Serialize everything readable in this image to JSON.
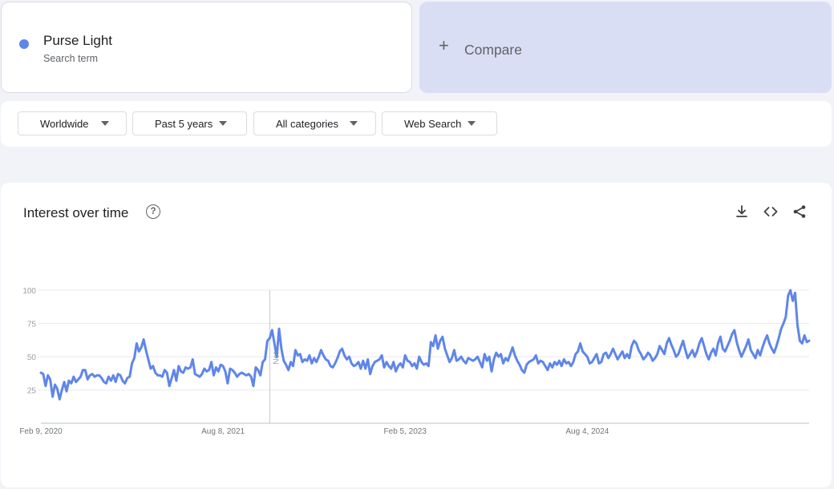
{
  "search_term": {
    "name": "Purse Light",
    "subtitle": "Search term",
    "color": "#5f86e8"
  },
  "compare": {
    "label": "Compare"
  },
  "filters": [
    {
      "label": "Worldwide"
    },
    {
      "label": "Past 5 years"
    },
    {
      "label": "All categories"
    },
    {
      "label": "Web Search"
    }
  ],
  "chart_card": {
    "title": "Interest over time",
    "icons": [
      "help-icon",
      "download-icon",
      "embed-code-icon",
      "share-icon"
    ]
  },
  "chart_data": {
    "type": "line",
    "title": "Interest over time",
    "xlabel": "",
    "ylabel": "",
    "ylim": [
      0,
      100
    ],
    "yticks": [
      25,
      50,
      75,
      100
    ],
    "x_tick_labels": [
      {
        "label": "Feb 9, 2020",
        "week_index": 0
      },
      {
        "label": "Aug 8, 2021",
        "week_index": 78
      },
      {
        "label": "Feb 5, 2023",
        "week_index": 156
      },
      {
        "label": "Aug 4, 2024",
        "week_index": 234
      }
    ],
    "annotation": {
      "label": "Note",
      "week_index": 98
    },
    "grid": true,
    "legend": "none",
    "series": [
      {
        "color": "#5f86e8",
        "x_start": "Feb 9, 2020",
        "x_step": "1 week",
        "values": [
          38,
          37,
          28,
          36,
          33,
          20,
          29,
          26,
          18,
          25,
          31,
          24,
          32,
          30,
          35,
          31,
          33,
          35,
          40,
          40,
          33,
          36,
          37,
          35,
          36,
          36,
          34,
          31,
          30,
          35,
          32,
          36,
          31,
          37,
          36,
          32,
          30,
          34,
          35,
          45,
          49,
          60,
          54,
          57,
          63,
          55,
          48,
          41,
          43,
          38,
          36,
          36,
          35,
          40,
          38,
          28,
          34,
          40,
          32,
          43,
          39,
          38,
          42,
          41,
          42,
          48,
          37,
          36,
          35,
          37,
          41,
          39,
          40,
          46,
          36,
          42,
          39,
          44,
          43,
          39,
          30,
          41,
          40,
          38,
          35,
          37,
          38,
          37,
          36,
          37,
          35,
          28,
          42,
          40,
          36,
          46,
          48,
          62,
          64,
          70,
          60,
          50,
          71,
          56,
          47,
          44,
          40,
          46,
          43,
          55,
          51,
          52,
          46,
          48,
          47,
          51,
          45,
          49,
          46,
          50,
          55,
          51,
          48,
          47,
          43,
          42,
          45,
          49,
          54,
          56,
          51,
          48,
          50,
          45,
          43,
          44,
          46,
          41,
          47,
          41,
          48,
          37,
          43,
          46,
          47,
          48,
          51,
          42,
          46,
          43,
          41,
          46,
          39,
          43,
          45,
          42,
          51,
          47,
          46,
          43,
          45,
          41,
          50,
          46,
          44,
          45,
          43,
          61,
          58,
          66,
          56,
          62,
          65,
          56,
          51,
          46,
          49,
          55,
          47,
          48,
          50,
          47,
          45,
          49,
          48,
          47,
          48,
          50,
          46,
          42,
          52,
          47,
          50,
          39,
          48,
          53,
          50,
          52,
          45,
          49,
          47,
          52,
          57,
          51,
          47,
          44,
          40,
          38,
          44,
          46,
          47,
          48,
          51,
          45,
          47,
          46,
          43,
          40,
          45,
          42,
          46,
          44,
          47,
          43,
          48,
          45,
          46,
          43,
          46,
          52,
          54,
          60,
          54,
          52,
          50,
          45,
          46,
          49,
          52,
          45,
          46,
          52,
          53,
          49,
          52,
          56,
          52,
          48,
          51,
          54,
          49,
          52,
          49,
          58,
          62,
          60,
          55,
          52,
          48,
          50,
          53,
          51,
          47,
          49,
          52,
          58,
          55,
          52,
          60,
          64,
          59,
          55,
          50,
          52,
          57,
          62,
          55,
          49,
          52,
          55,
          50,
          54,
          60,
          64,
          58,
          52,
          48,
          53,
          56,
          51,
          60,
          65,
          56,
          54,
          58,
          62,
          67,
          70,
          61,
          55,
          50,
          54,
          58,
          63,
          55,
          52,
          49,
          55,
          51,
          57,
          62,
          66,
          60,
          56,
          53,
          58,
          64,
          71,
          75,
          80,
          96,
          100,
          92,
          98,
          74,
          62,
          60,
          66,
          61,
          62
        ]
      }
    ]
  }
}
